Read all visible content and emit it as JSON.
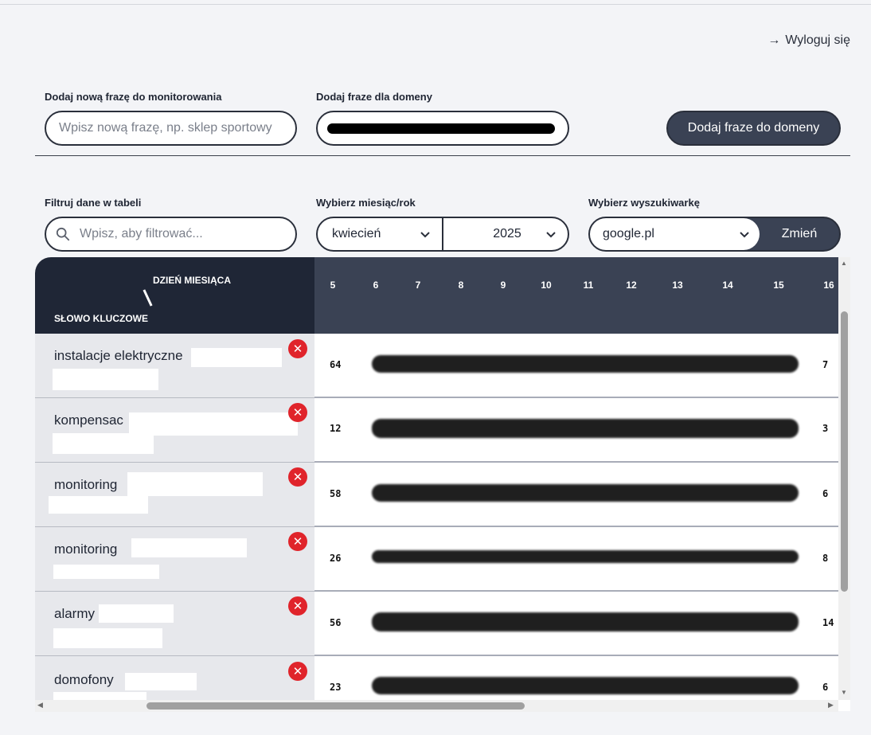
{
  "header": {
    "logout_label": "Wyloguj się"
  },
  "add_phrase": {
    "label": "Dodaj nową frazę do monitorowania",
    "placeholder": "Wpisz nową frazę, np. sklep sportowy",
    "domain_label": "Dodaj fraze dla domeny",
    "button_label": "Dodaj fraze do domeny"
  },
  "filters": {
    "filter_label": "Filtruj dane w tabeli",
    "filter_placeholder": "Wpisz, aby filtrować...",
    "month_year_label": "Wybierz miesiąc/rok",
    "month_value": "kwiecień",
    "year_value": "2025",
    "engine_label": "Wybierz wyszukiwarkę",
    "engine_value": "google.pl",
    "change_button": "Zmień"
  },
  "table": {
    "day_header": "DZIEŃ MIESIĄCA",
    "keyword_header": "SŁOWO KLUCZOWE",
    "days": [
      "5",
      "6",
      "7",
      "8",
      "9",
      "10",
      "11",
      "12",
      "13",
      "14",
      "15",
      "16"
    ],
    "rows": [
      {
        "keyword": "instalacje elektryczne",
        "first": "64",
        "last": "7"
      },
      {
        "keyword": "kompensac",
        "first": "12",
        "last": "3"
      },
      {
        "keyword": "monitoring",
        "first": "58",
        "last": "6"
      },
      {
        "keyword": "monitoring",
        "first": "26",
        "last": "8"
      },
      {
        "keyword": "alarmy",
        "first": "56",
        "last": "14"
      },
      {
        "keyword": "domofony",
        "first": "23",
        "last": "6"
      }
    ]
  },
  "colors": {
    "accent_dark": "#3a4254",
    "header_dark": "#1f2636",
    "delete_red": "#e0242b"
  },
  "icons": [
    "arrow-right-icon",
    "search-icon",
    "chevron-down-icon",
    "close-icon"
  ]
}
